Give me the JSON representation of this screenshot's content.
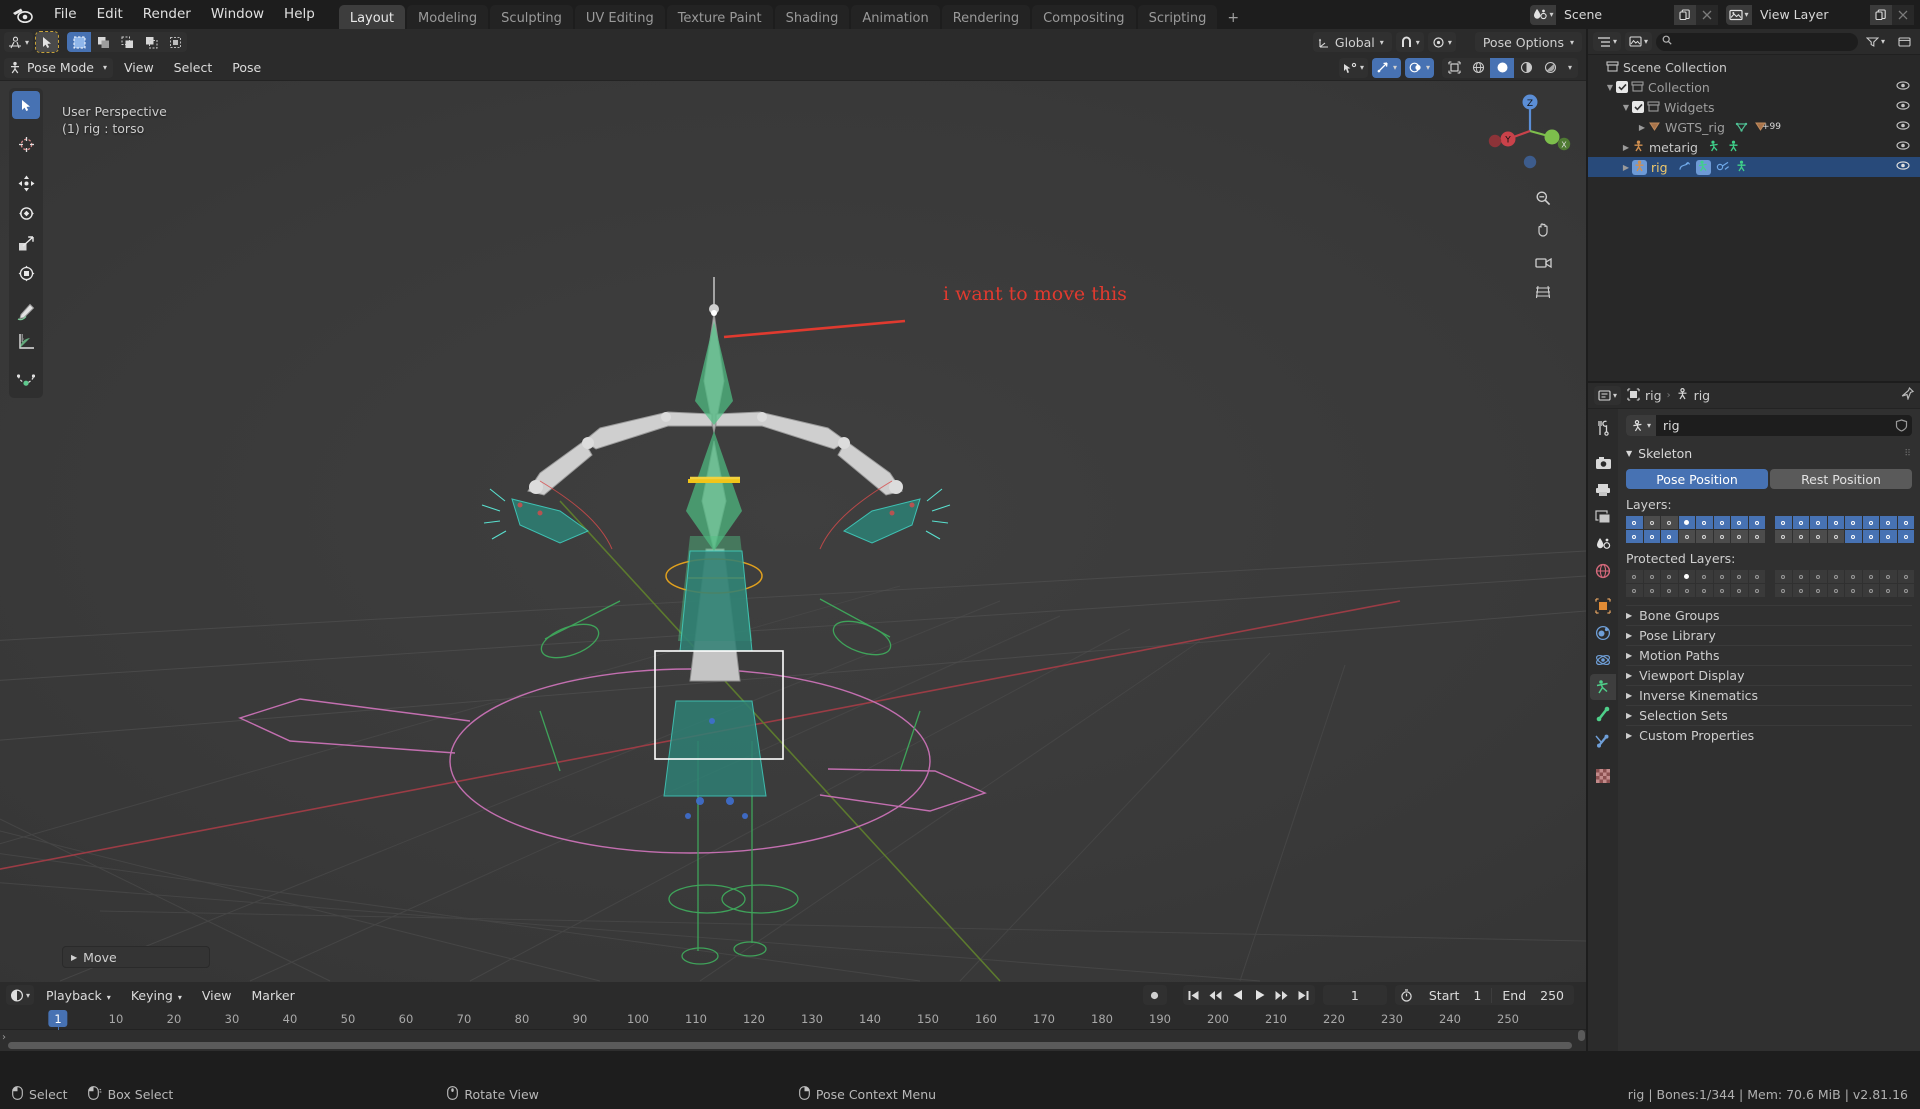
{
  "topbar": {
    "logo_icon": "blender-logo-icon",
    "menus": [
      "File",
      "Edit",
      "Render",
      "Window",
      "Help"
    ],
    "workspaces": [
      "Layout",
      "Modeling",
      "Sculpting",
      "UV Editing",
      "Texture Paint",
      "Shading",
      "Animation",
      "Rendering",
      "Compositing",
      "Scripting"
    ],
    "add_workspace_label": "+",
    "active_workspace": "Layout",
    "scene": {
      "icon": "scene-icon",
      "name": "Scene",
      "new_icon": "duplicate-icon",
      "unlink_icon": "x-icon"
    },
    "view_layer": {
      "icon": "view-layer-icon",
      "name": "View Layer",
      "new_icon": "duplicate-icon",
      "unlink_icon": "x-icon"
    }
  },
  "viewport": {
    "editor_type_icon": "editor-type-3dview-icon",
    "mode": "Pose Mode",
    "menus": [
      "View",
      "Select",
      "Pose"
    ],
    "transform_orientation": {
      "icon": "orientation-icon",
      "label": "Global"
    },
    "snap_icon": "magnet-icon",
    "proportional_icon": "proportional-edit-icon",
    "pose_options_label": "Pose Options",
    "select_mode_icons": [
      "select-box-icon",
      "select-new-icon",
      "select-extend-icon",
      "select-subtract-icon",
      "select-difference-icon"
    ],
    "cursor_tool_icon": "tweak-cursor-icon",
    "overlay_text_line1": "User Perspective",
    "overlay_text_line2": "(1) rig : torso",
    "toolbar_tools": [
      "select-box-tool-icon",
      "cursor-tool-icon",
      "move-tool-icon",
      "rotate-tool-icon",
      "scale-tool-icon",
      "transform-tool-icon",
      "annotate-tool-icon",
      "measure-tool-icon",
      "breakdowner-tool-icon"
    ],
    "gizmo_axes": {
      "x": "X",
      "y": "Y",
      "z": "Z"
    },
    "nav_icons": [
      "zoom-icon",
      "hand-pan-icon",
      "camera-view-icon",
      "orthographic-toggle-icon"
    ],
    "shading_icons": [
      "shading-wireframe-icon",
      "shading-solid-icon",
      "shading-material-icon",
      "shading-rendered-icon"
    ],
    "visibility_icons": [
      "show-gizmo-icon",
      "show-overlays-icon",
      "xray-toggle-icon"
    ],
    "operator_panel": {
      "label": "Move",
      "expand_icon": "chevron-right-icon"
    },
    "annotation": "i want to move this",
    "annotation_color": "#e03a2f"
  },
  "outliner": {
    "editor_icon": "outliner-icon",
    "display_mode_icon": "view-layer-icon",
    "search_placeholder": "",
    "search_icon": "search-icon",
    "filter_icon": "filter-icon",
    "new_collection_icon": "new-collection-icon",
    "rows": [
      {
        "label": "Scene Collection",
        "icon": "collection-icon",
        "indent": 0,
        "has_tri": false,
        "has_check": false,
        "selected": false,
        "eye": false,
        "dim": false
      },
      {
        "label": "Collection",
        "icon": "collection-icon",
        "indent": 1,
        "has_tri": true,
        "has_check": true,
        "checked": true,
        "selected": false,
        "eye": true,
        "dim": true
      },
      {
        "label": "Widgets",
        "icon": "collection-icon",
        "indent": 2,
        "has_tri": true,
        "has_check": true,
        "checked": true,
        "selected": false,
        "eye": true,
        "dim": true
      },
      {
        "label": "WGTS_rig",
        "icon": "empty-axes-icon",
        "indent": 3,
        "has_tri": true,
        "has_check": false,
        "selected": false,
        "eye": true,
        "dim": true,
        "badges": [
          "mesh-data-icon",
          "empty-plus99-icon"
        ],
        "badge_count": "+99"
      },
      {
        "label": "metarig",
        "icon": "armature-icon",
        "indent": 2,
        "has_tri": true,
        "has_check": false,
        "selected": false,
        "eye": true,
        "dim": false,
        "badges": [
          "pose-icon",
          "armature-data-icon"
        ]
      },
      {
        "label": "rig",
        "icon": "armature-icon",
        "indent": 2,
        "has_tri": true,
        "has_check": false,
        "selected": true,
        "eye": true,
        "dim": false,
        "badges": [
          "animation-icon",
          "pose-icon",
          "modifier-icon",
          "armature-data-icon"
        ]
      }
    ]
  },
  "properties": {
    "editor_icon": "properties-icon",
    "breadcrumb": [
      {
        "icon": "object-icon",
        "label": "rig"
      },
      {
        "icon": "armature-data-icon",
        "label": "rig"
      }
    ],
    "pin_icon": "pin-icon",
    "tabs": [
      {
        "name": "tool-tab",
        "icon": "tool-icon",
        "active": false
      },
      {
        "name": "render-tab",
        "icon": "camera-back-icon",
        "active": false
      },
      {
        "name": "output-tab",
        "icon": "printer-icon",
        "active": false
      },
      {
        "name": "view-layer-tab",
        "icon": "images-icon",
        "active": false
      },
      {
        "name": "scene-tab",
        "icon": "scene-cone-icon",
        "active": false
      },
      {
        "name": "world-tab",
        "icon": "world-icon",
        "active": false
      },
      {
        "name": "object-tab",
        "icon": "object-square-icon",
        "active": false
      },
      {
        "name": "modifiers-tab",
        "icon": "wrench-icon",
        "active": false
      },
      {
        "name": "physics-tab",
        "icon": "physics-icon",
        "active": false
      },
      {
        "name": "constraints-tab",
        "icon": "constraints-icon",
        "active": true
      },
      {
        "name": "data-tab",
        "icon": "bone-icon",
        "active": false
      },
      {
        "name": "bone-constraint-tab",
        "icon": "bone-constraint-icon",
        "active": false
      },
      {
        "name": "texture-tab",
        "icon": "checker-texture-icon",
        "active": false
      }
    ],
    "datablock": {
      "icon": "armature-data-icon",
      "name": "rig",
      "shield_icon": "fake-user-icon"
    },
    "skeleton": {
      "title": "Skeleton",
      "expand_icon": "chevron-down-icon",
      "pose_position_label": "Pose Position",
      "rest_position_label": "Rest Position",
      "active_position": "Pose Position",
      "layers_label": "Layers:",
      "protected_layers_label": "Protected Layers:",
      "layers_left_row1": [
        1,
        0,
        0,
        2,
        1,
        1,
        1,
        1
      ],
      "layers_left_row2": [
        1,
        1,
        1,
        0,
        0,
        0,
        0,
        0
      ],
      "layers_right_row1": [
        1,
        1,
        1,
        1,
        1,
        1,
        1,
        1
      ],
      "layers_right_row2": [
        0,
        0,
        0,
        0,
        1,
        1,
        1,
        1
      ],
      "protected_left_row1": [
        0,
        0,
        0,
        2,
        0,
        0,
        0,
        0
      ],
      "protected_left_row2": [
        0,
        0,
        0,
        0,
        0,
        0,
        0,
        0
      ],
      "protected_right_row1": [
        0,
        0,
        0,
        0,
        0,
        0,
        0,
        0
      ],
      "protected_right_row2": [
        0,
        0,
        0,
        0,
        0,
        0,
        0,
        0
      ]
    },
    "panels": [
      "Bone Groups",
      "Pose Library",
      "Motion Paths",
      "Viewport Display",
      "Inverse Kinematics",
      "Selection Sets",
      "Custom Properties"
    ]
  },
  "timeline": {
    "editor_icon": "timeline-icon",
    "menus": [
      "Playback",
      "Keying",
      "View",
      "Marker"
    ],
    "transport_icons": [
      "record-icon",
      "jump-start-icon",
      "prev-keyframe-icon",
      "play-reverse-icon",
      "play-icon",
      "next-keyframe-icon",
      "jump-end-icon"
    ],
    "current_frame": "1",
    "frame_icon": "stopwatch-icon",
    "start_label": "Start",
    "start_value": "1",
    "end_label": "End",
    "end_value": "250",
    "ticks": [
      "1",
      "10",
      "20",
      "30",
      "40",
      "50",
      "60",
      "70",
      "80",
      "90",
      "100",
      "110",
      "120",
      "130",
      "140",
      "150",
      "160",
      "170",
      "180",
      "190",
      "200",
      "210",
      "220",
      "230",
      "240",
      "250"
    ],
    "playhead_frame": "1"
  },
  "statusbar": {
    "items": [
      {
        "icon": "mouse-left-icon",
        "label": "Select"
      },
      {
        "icon": "mouse-right-drag-icon",
        "label": "Box Select"
      },
      {
        "icon": "mouse-middle-icon",
        "label": "Rotate View"
      },
      {
        "icon": "mouse-right-icon",
        "label": "Pose Context Menu"
      }
    ],
    "info": "rig | Bones:1/344  | Mem: 70.6 MiB | v2.81.16"
  }
}
